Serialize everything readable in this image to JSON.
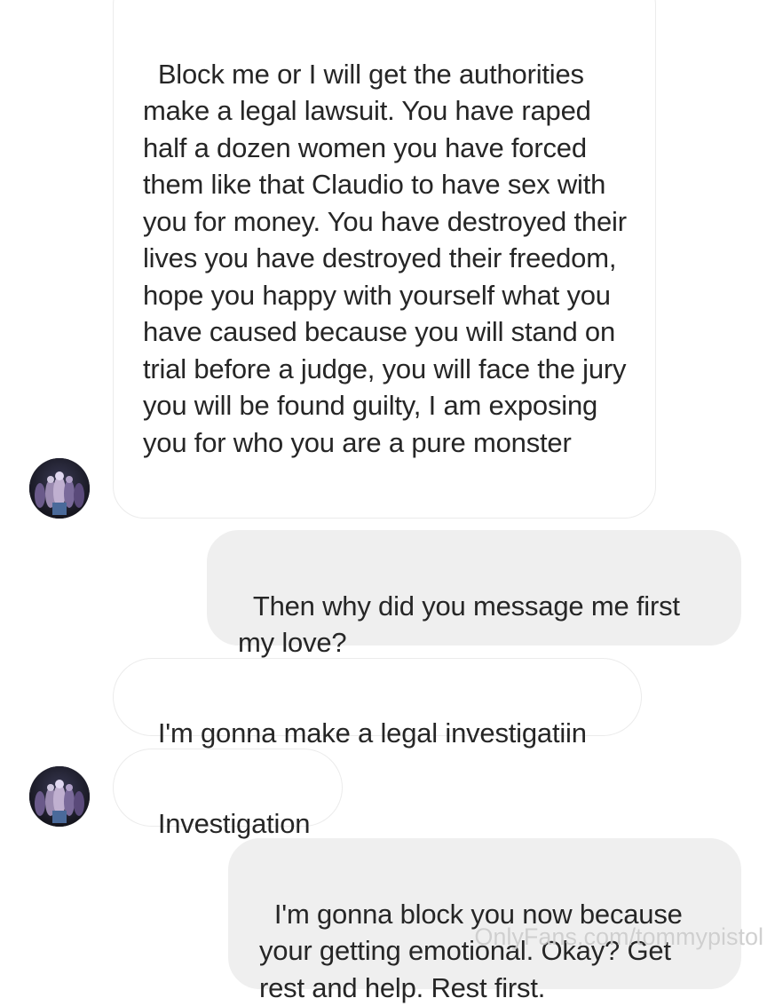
{
  "conversation": {
    "messages": [
      {
        "direction": "incoming",
        "text": "Block me or I will get the authorities make a legal lawsuit. You have raped half a dozen women you have forced them like that Claudio to have sex with you for money. You have destroyed their lives you have destroyed their freedom, hope you happy with yourself what you have caused because you will stand on trial before a judge, you will face the jury you will be found guilty, I am exposing you for who you are a pure monster"
      },
      {
        "direction": "outgoing",
        "text": "Then why did you message me first my love?"
      },
      {
        "direction": "incoming",
        "text": "I'm gonna make a legal investigatiin"
      },
      {
        "direction": "incoming",
        "text": "Investigation"
      },
      {
        "direction": "outgoing",
        "text": "I'm gonna block you now because your getting emotional. Okay? Get rest and help. Rest first."
      }
    ],
    "avatar_icon": "contact-avatar-icon"
  },
  "watermark": "OnlyFans.com/tommypistol",
  "colors": {
    "incoming_bg": "#ffffff",
    "incoming_border": "#ebebeb",
    "outgoing_bg": "#efefef",
    "text": "#262626"
  }
}
